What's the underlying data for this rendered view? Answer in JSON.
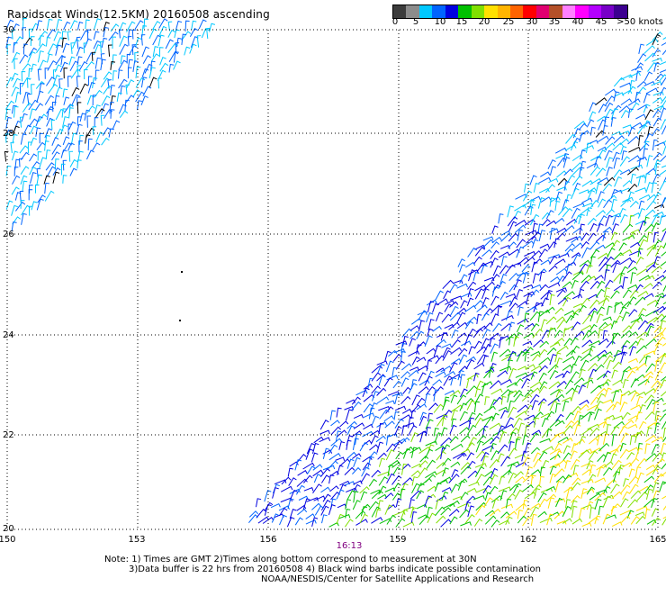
{
  "title": "Rapidscat Winds(12.5KM) 20160508 ascending",
  "colorbar": {
    "labels": [
      "0",
      "5",
      "10",
      "15",
      "20",
      "25",
      "30",
      "35",
      "40",
      "45",
      ">50 knots"
    ],
    "colors": [
      "#3c3c3c",
      "#8c8c8c",
      "#00c8ff",
      "#0064ff",
      "#0000e0",
      "#00c000",
      "#80e000",
      "#ffe000",
      "#ffb400",
      "#ff6400",
      "#ff0000",
      "#e00070",
      "#b45028",
      "#ff80ff",
      "#ff00ff",
      "#b400ff",
      "#7800c8",
      "#3c0090"
    ]
  },
  "map": {
    "lon_ticks": [
      "150",
      "153",
      "156",
      "159",
      "162",
      "165"
    ],
    "lat_ticks": [
      "30",
      "28",
      "26",
      "24",
      "22",
      "20"
    ],
    "time_label": "16:13",
    "time_color": "#800080"
  },
  "notes": {
    "line1": "Note: 1) Times are GMT 2)Times along bottom correspond to measurement at 30N",
    "line2": "3)Data buffer is 22 hrs from 20160508 4) Black wind barbs indicate possible contamination",
    "line3": "NOAA/NESDIS/Center for Satellite Applications and Research"
  }
}
